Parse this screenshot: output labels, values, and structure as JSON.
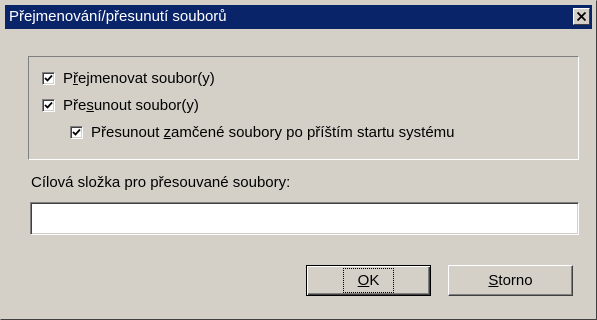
{
  "window": {
    "title": "Přejmenování/přesunutí souborů",
    "close_icon": "close-x-icon"
  },
  "options": [
    {
      "prefix": "P",
      "accel": "ř",
      "rest": "ejmenovat soubor(y)",
      "checked": true
    },
    {
      "prefix": "Pře",
      "accel": "s",
      "rest": "unout soubor(y)",
      "checked": true
    },
    {
      "prefix": "Přesunout ",
      "accel": "z",
      "rest": "amčené soubory po příštím startu systému",
      "checked": true
    }
  ],
  "destination": {
    "label": "Cílová složka pro přesouvané soubory:",
    "value": ""
  },
  "buttons": {
    "ok": {
      "accel": "O",
      "rest": "K"
    },
    "cancel": {
      "accel": "S",
      "rest": "torno"
    }
  },
  "colors": {
    "titlebar": "#0a246a",
    "face": "#d4d0c8"
  }
}
